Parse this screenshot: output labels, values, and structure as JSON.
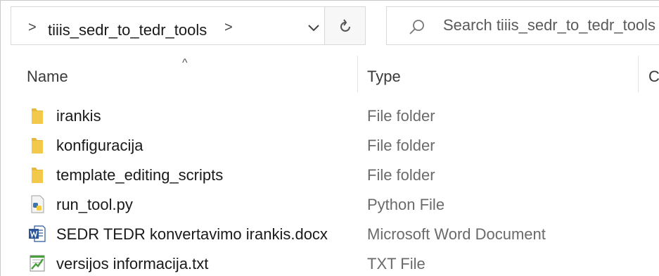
{
  "address_bar": {
    "path_chevron": ">",
    "folder": "tiiis_sedr_to_tedr_tools",
    "separator": ">",
    "dropdown_icon": "chevron-down-icon",
    "refresh_icon": "refresh-icon"
  },
  "search": {
    "placeholder": "Search tiiis_sedr_to_tedr_tools",
    "icon": "search-icon"
  },
  "columns": {
    "sort_indicator": "^",
    "name": "Name",
    "type": "Type",
    "next": "C"
  },
  "files": [
    {
      "name": "irankis",
      "type": "File folder",
      "icon": "folder-icon"
    },
    {
      "name": "konfiguracija",
      "type": "File folder",
      "icon": "folder-icon"
    },
    {
      "name": "template_editing_scripts",
      "type": "File folder",
      "icon": "folder-icon"
    },
    {
      "name": "run_tool.py",
      "type": "Python File",
      "icon": "python-file-icon"
    },
    {
      "name": "SEDR TEDR konvertavimo irankis.docx",
      "type": "Microsoft Word Document",
      "icon": "word-document-icon"
    },
    {
      "name": "versijos informacija.txt",
      "type": "TXT File",
      "icon": "text-file-icon"
    }
  ],
  "colors": {
    "folder": "#e8b83c",
    "word": "#2b579a",
    "python_blue": "#3a75b0",
    "python_yellow": "#f2cd3c",
    "text_green": "#4a9e3e"
  }
}
